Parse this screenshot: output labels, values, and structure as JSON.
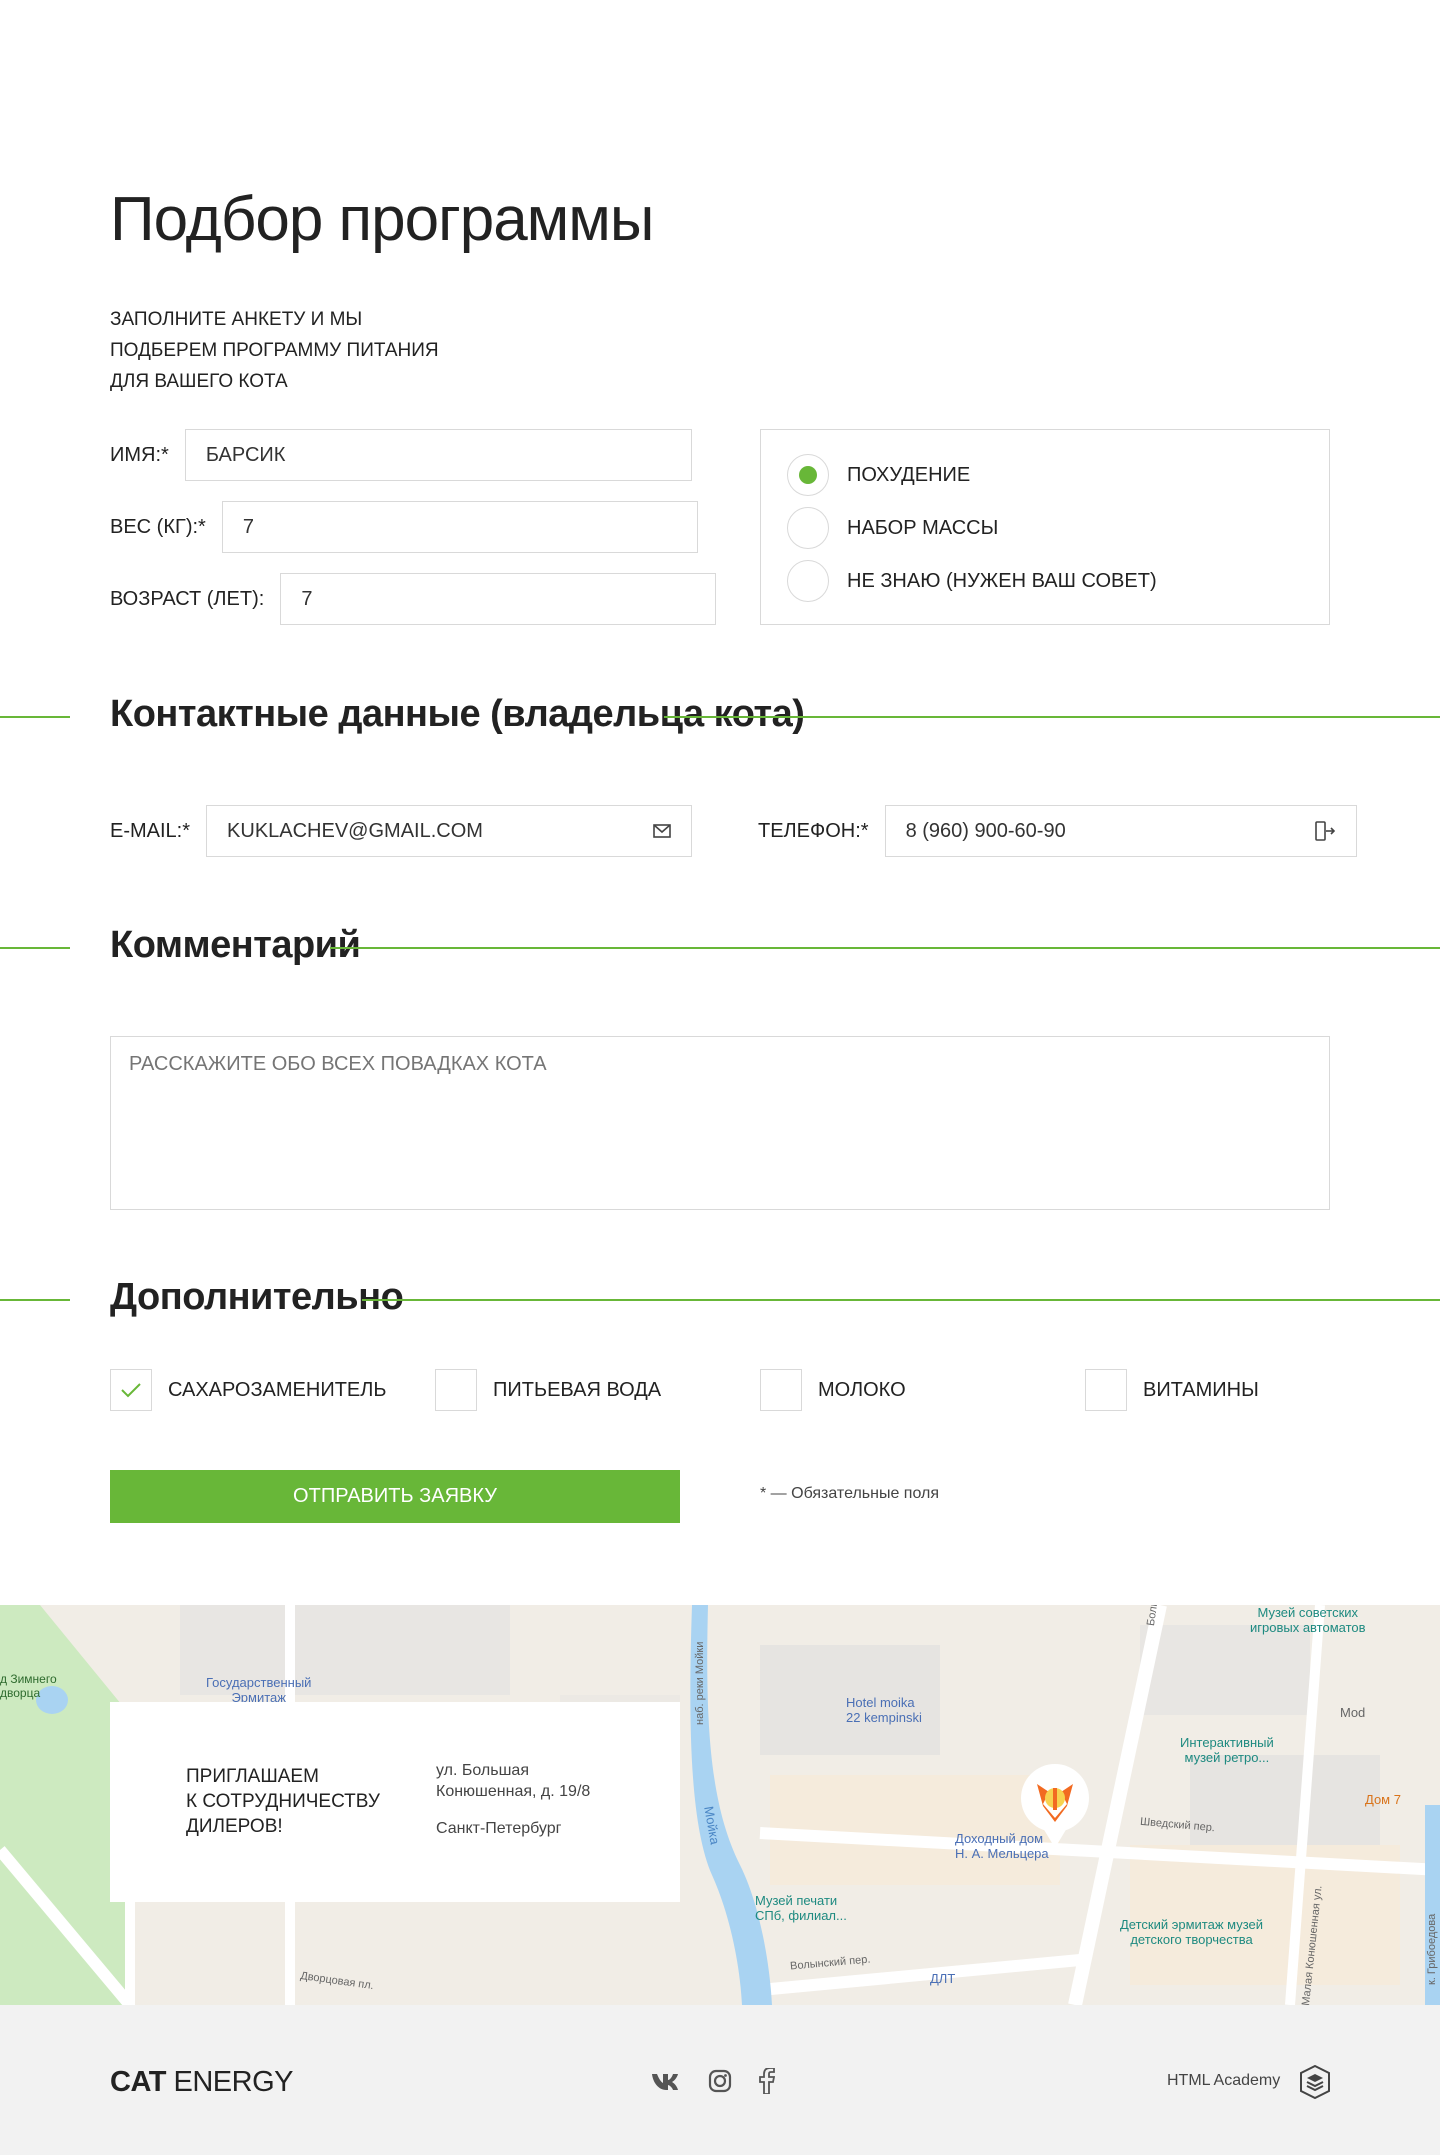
{
  "form": {
    "title": "Подбор программы",
    "intro": "Заполните анкету и мы подберем программу питания для вашего кота",
    "name_label": "Имя:*",
    "name_value": "Барсик",
    "weight_label": "Вес (кг):*",
    "weight_value": "7",
    "age_label": "Возраст (лет):",
    "age_value": "7",
    "goals": [
      {
        "label": "Похудение",
        "checked": true
      },
      {
        "label": "Набор массы",
        "checked": false
      },
      {
        "label": "Не знаю (нужен ваш совет)",
        "checked": false
      }
    ]
  },
  "contacts": {
    "title": "Контактные данные (владельца кота)",
    "email_label": "E-mail:*",
    "email_value": "kuklachev@gmail.com",
    "email_icon": "mail-icon",
    "phone_label": "Телефон:*",
    "phone_value": "8 (960) 900-60-90",
    "phone_icon": "phone-icon"
  },
  "comment": {
    "title": "Комментарий",
    "placeholder": "Расскажите обо всех повадках кота"
  },
  "extra": {
    "title": "Дополнительно",
    "options": [
      {
        "label": "Сахарозаменитель",
        "checked": true
      },
      {
        "label": "Питьевая вода",
        "checked": false
      },
      {
        "label": "Молоко",
        "checked": false
      },
      {
        "label": "Витамины",
        "checked": false
      }
    ]
  },
  "submit_label": "Отправить заявку",
  "required_note": "* — Обязательные поля",
  "map": {
    "invite": "Приглашаем\nк сотрудничеству\nдилеров!",
    "address": "ул. Большая\nКонюшенная, д. 19/8",
    "city": "Санкт-Петербург",
    "labels": {
      "winter_palace": "д Зимнего\nдворца",
      "hermitage": "Государственный\nЭрмитаж",
      "moika_hotel": "Hotel moika\n22 kempinski",
      "museum_arcade": "Музей советских\nигровых автоматов",
      "interactive": "Интерактивный\nмузей ретро...",
      "mod": "Mod",
      "dom7": "Дом 7",
      "profit_house": "Доходный дом\nН. А. Мельцера",
      "print_museum": "Музей печати\nСПб, филиал...",
      "kids_hermitage": "Детский эрмитаж музей\nдетского творчества",
      "dlt": "ДЛТ",
      "moika": "Мойка",
      "shvedsky": "Шведский пер.",
      "volynsky": "Волынский пер.",
      "dvortsovaya": "Дворцовая пл.",
      "konyushennaya": "Большая Конюшенная ул.",
      "malaya_konyushennaya": "Малая Конюшенная ул.",
      "reki_moiki": "наб. реки Мойки",
      "griboedova": "к. Грибоедова"
    },
    "accent_color": "#68b738"
  },
  "footer": {
    "logo_bold": "CAT",
    "logo_rest": " ENERGY",
    "social": [
      "vk-icon",
      "instagram-icon",
      "facebook-icon"
    ],
    "academy": "HTML Academy"
  }
}
